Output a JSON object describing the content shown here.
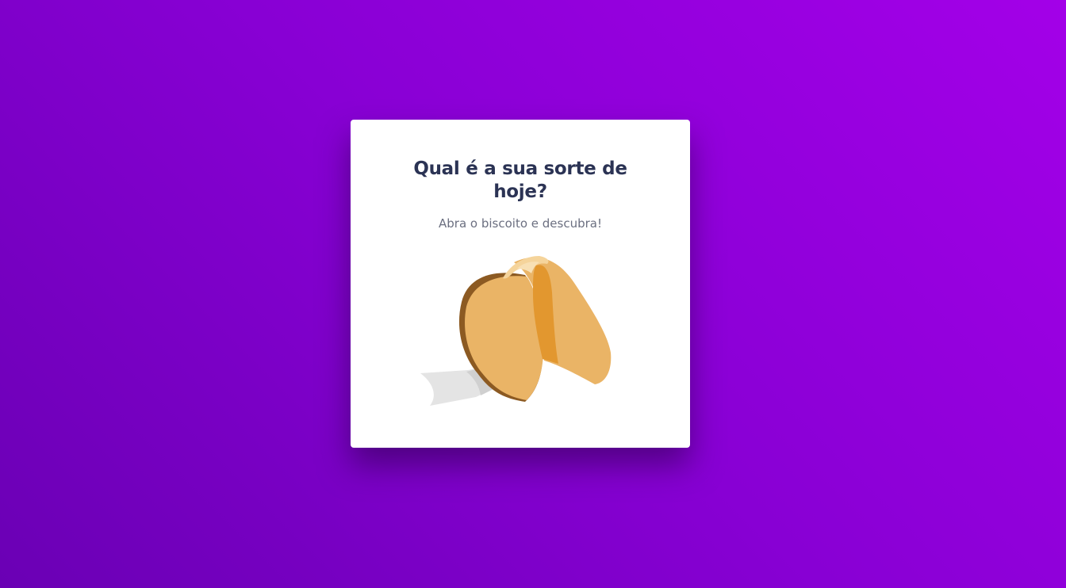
{
  "card": {
    "title": "Qual é a sua sorte de hoje?",
    "subtitle": "Abra o biscoito e descubra!"
  },
  "cookie": {
    "icon": "fortune-cookie-icon"
  },
  "colors": {
    "background_start": "#6a00b4",
    "background_end": "#a300e8",
    "card": "#ffffff",
    "title": "#2b3354",
    "subtitle": "#6b6f80",
    "cookie": "#eab466",
    "cookie_shadow": "#8c5a22",
    "cookie_inner": "#e2972f",
    "paper": "#e5e5e5"
  }
}
